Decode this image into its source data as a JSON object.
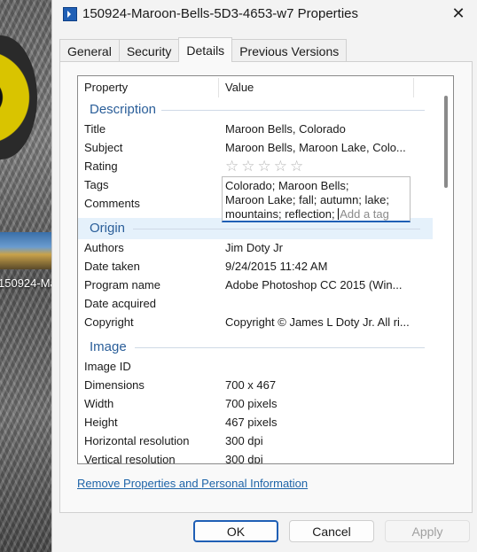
{
  "desktop": {
    "icon_label": "150924-Ma"
  },
  "window": {
    "title": "150924-Maroon-Bells-5D3-4653-w7 Properties"
  },
  "tabs": [
    "General",
    "Security",
    "Details",
    "Previous Versions"
  ],
  "active_tab": "Details",
  "list": {
    "headers": {
      "property": "Property",
      "value": "Value"
    },
    "sections": {
      "description": {
        "title": "Description",
        "rows": [
          {
            "key": "Title",
            "value": "Maroon Bells, Colorado"
          },
          {
            "key": "Subject",
            "value": "Maroon Bells, Maroon Lake, Colo..."
          },
          {
            "key": "Rating",
            "value": ""
          },
          {
            "key": "Tags",
            "value": ""
          },
          {
            "key": "Comments",
            "value": ""
          }
        ],
        "rating_stars": 0,
        "tags": {
          "line1": "Colorado; Maroon Bells;",
          "line2": "Maroon Lake; fall; autumn; lake;",
          "line3": "mountains; reflection;",
          "placeholder": "Add a tag"
        }
      },
      "origin": {
        "title": "Origin",
        "rows": [
          {
            "key": "Authors",
            "value": "Jim Doty Jr"
          },
          {
            "key": "Date taken",
            "value": "9/24/2015 11:42 AM"
          },
          {
            "key": "Program name",
            "value": "Adobe Photoshop CC 2015 (Win..."
          },
          {
            "key": "Date acquired",
            "value": ""
          },
          {
            "key": "Copyright",
            "value": "Copyright © James L Doty Jr. All ri..."
          }
        ]
      },
      "image": {
        "title": "Image",
        "rows": [
          {
            "key": "Image ID",
            "value": ""
          },
          {
            "key": "Dimensions",
            "value": "700 x 467"
          },
          {
            "key": "Width",
            "value": "700 pixels"
          },
          {
            "key": "Height",
            "value": "467 pixels"
          },
          {
            "key": "Horizontal resolution",
            "value": "300 dpi"
          },
          {
            "key": "Vertical resolution",
            "value": "300 dpi"
          }
        ]
      }
    }
  },
  "remove_link": "Remove Properties and Personal Information",
  "buttons": {
    "ok": "OK",
    "cancel": "Cancel",
    "apply": "Apply"
  }
}
